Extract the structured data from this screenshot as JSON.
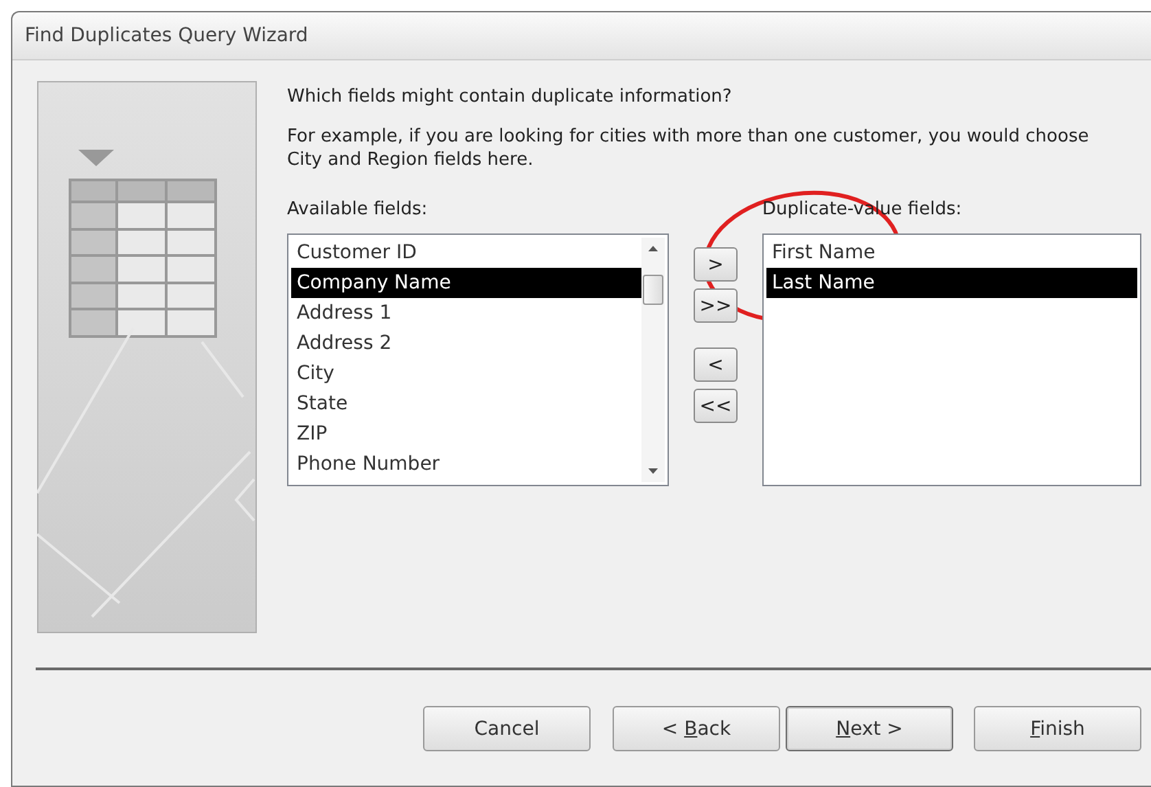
{
  "window": {
    "title": "Find Duplicates Query Wizard"
  },
  "question": "Which fields might contain duplicate information?",
  "explanation": "For example, if you are looking for cities with more than one customer, you would choose City and Region fields here.",
  "available": {
    "label": "Available fields:",
    "items": [
      {
        "text": "Customer ID",
        "selected": false
      },
      {
        "text": "Company Name",
        "selected": true
      },
      {
        "text": "Address 1",
        "selected": false
      },
      {
        "text": "Address 2",
        "selected": false
      },
      {
        "text": "City",
        "selected": false
      },
      {
        "text": "State",
        "selected": false
      },
      {
        "text": "ZIP",
        "selected": false
      },
      {
        "text": "Phone Number",
        "selected": false
      }
    ]
  },
  "move_buttons": [
    ">",
    ">>",
    "<",
    "<<"
  ],
  "duplicates": {
    "label": "Duplicate-value fields:",
    "items": [
      {
        "text": "First Name",
        "selected": false
      },
      {
        "text": "Last Name",
        "selected": true
      }
    ]
  },
  "buttons": [
    {
      "after": "Cancel",
      "default": false
    },
    {
      "before": "< ",
      "key": "B",
      "after": "ack",
      "default": false
    },
    {
      "key": "N",
      "after": "ext >",
      "default": true
    },
    {
      "key": "F",
      "after": "inish",
      "default": false
    }
  ]
}
